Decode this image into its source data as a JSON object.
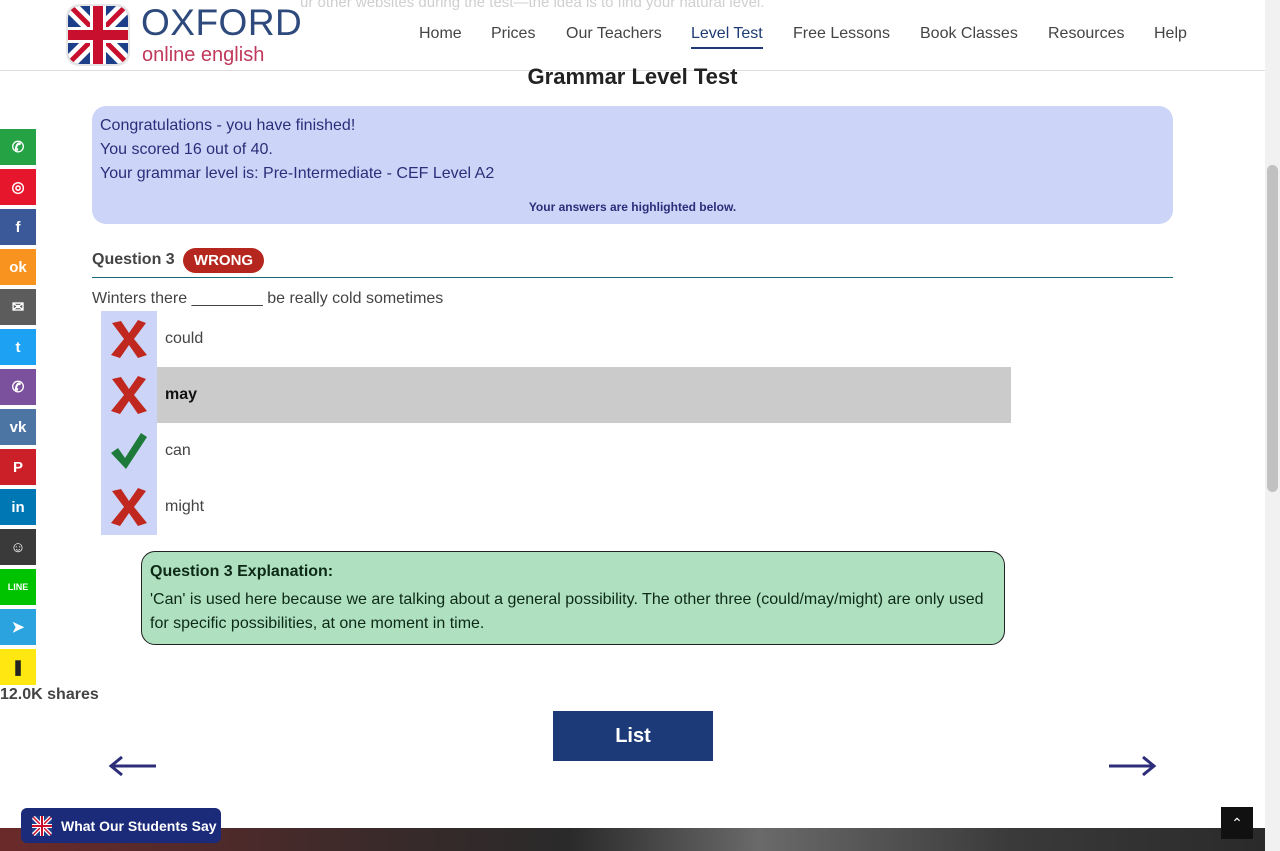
{
  "header": {
    "ghost_text": "ur other websites during the test—the idea is to find your natural level.",
    "logo_title": "OXFORD",
    "logo_subtitle": "online english",
    "nav": [
      "Home",
      "Prices",
      "Our Teachers",
      "Level Test",
      "Free Lessons",
      "Book Classes",
      "Resources",
      "Help"
    ],
    "active_nav": "Level Test"
  },
  "page_title": "Grammar Level Test",
  "result": {
    "line1": "Congratulations - you have finished!",
    "line2": "You scored 16 out of 40.",
    "line3": "Your grammar level is: Pre-Intermediate - CEF Level A2",
    "note": "Your answers are highlighted below."
  },
  "question": {
    "label": "Question 3",
    "status": "WRONG",
    "text": "Winters there ________ be really cold sometimes",
    "options": [
      {
        "label": "could",
        "icon": "cross-icon",
        "selected": false
      },
      {
        "label": "may",
        "icon": "cross-icon",
        "selected": true
      },
      {
        "label": "can",
        "icon": "check-icon",
        "selected": false
      },
      {
        "label": "might",
        "icon": "cross-icon",
        "selected": false
      }
    ]
  },
  "explanation": {
    "title": "Question 3 Explanation:",
    "body": "'Can' is used here because we are talking about a general possibility. The other three (could/may/might) are only used for specific possibilities, at one moment in time."
  },
  "share": {
    "count": "12.0K shares",
    "buttons": [
      {
        "name": "whatsapp",
        "color": "#25a244",
        "glyph": "✆"
      },
      {
        "name": "weibo",
        "color": "#e6162d",
        "glyph": "◎"
      },
      {
        "name": "facebook",
        "color": "#3b5998",
        "glyph": "f"
      },
      {
        "name": "odnoklassniki",
        "color": "#f7931e",
        "glyph": "ok"
      },
      {
        "name": "email",
        "color": "#5c5c5c",
        "glyph": "✉"
      },
      {
        "name": "twitter",
        "color": "#1da1f2",
        "glyph": "t"
      },
      {
        "name": "viber",
        "color": "#7b519d",
        "glyph": "✆"
      },
      {
        "name": "vk",
        "color": "#4c75a3",
        "glyph": "vk"
      },
      {
        "name": "pinterest",
        "color": "#cb2027",
        "glyph": "P"
      },
      {
        "name": "linkedin",
        "color": "#0077b5",
        "glyph": "in"
      },
      {
        "name": "reddit",
        "color": "#3a3a3a",
        "glyph": "☺"
      },
      {
        "name": "line",
        "color": "#00c300",
        "glyph": "LINE"
      },
      {
        "name": "telegram",
        "color": "#2aa3de",
        "glyph": "➤"
      },
      {
        "name": "kakao",
        "color": "#ffe812",
        "glyph": "❚"
      }
    ]
  },
  "list_button": "List",
  "arrows": {
    "prev": "←",
    "next": "→"
  },
  "students_button": "What Our Students Say",
  "top_button": "⌃",
  "colors": {
    "brand_blue": "#1c3a78",
    "wrong_red": "#b5271e",
    "correct_green": "#1e7a3a",
    "result_bg": "#ccd4f7",
    "explain_bg": "#afe0c0"
  }
}
